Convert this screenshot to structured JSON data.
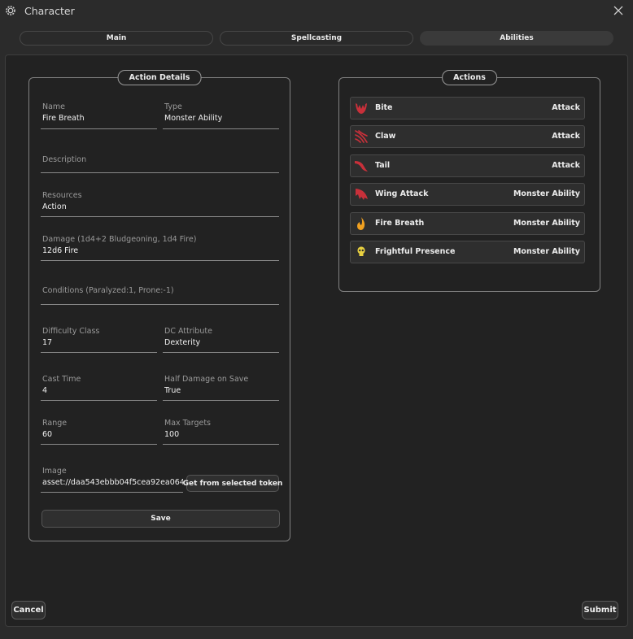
{
  "window": {
    "title": "Character",
    "app_icon": "gear-icon",
    "close_icon": "close-icon"
  },
  "tabs": [
    {
      "label": "Main"
    },
    {
      "label": "Spellcasting"
    },
    {
      "label": "Abilities",
      "selected": true
    }
  ],
  "details": {
    "title": "Action Details",
    "fields": {
      "name": {
        "label": "Name",
        "value": "Fire Breath"
      },
      "type": {
        "label": "Type",
        "value": "Monster Ability"
      },
      "description": {
        "label": "Description",
        "value": ""
      },
      "resources": {
        "label": "Resources",
        "value": "Action"
      },
      "damage": {
        "label": "Damage (1d4+2 Bludgeoning, 1d4 Fire)",
        "value": "12d6 Fire"
      },
      "conditions": {
        "label": "Conditions (Paralyzed:1, Prone:-1)",
        "value": ""
      },
      "dc": {
        "label": "Difficulty Class",
        "value": "17"
      },
      "dc_attribute": {
        "label": "DC Attribute",
        "value": "Dexterity"
      },
      "cast_time": {
        "label": "Cast Time",
        "value": "4"
      },
      "half_damage": {
        "label": "Half Damage on Save",
        "value": "True"
      },
      "range": {
        "label": "Range",
        "value": "60"
      },
      "max_targets": {
        "label": "Max Targets",
        "value": "100"
      },
      "image": {
        "label": "Image",
        "value": "asset://daa543ebbb04f5cea92ea064"
      }
    },
    "get_token_label": "Get from selected token",
    "save_label": "Save"
  },
  "actions": {
    "title": "Actions",
    "items": [
      {
        "name": "Bite",
        "type": "Attack",
        "icon": "bite-icon"
      },
      {
        "name": "Claw",
        "type": "Attack",
        "icon": "claw-icon"
      },
      {
        "name": "Tail",
        "type": "Attack",
        "icon": "tail-icon"
      },
      {
        "name": "Wing Attack",
        "type": "Monster Ability",
        "icon": "wing-icon"
      },
      {
        "name": "Fire Breath",
        "type": "Monster Ability",
        "icon": "flame-icon"
      },
      {
        "name": "Frightful Presence",
        "type": "Monster Ability",
        "icon": "skull-icon"
      }
    ]
  },
  "footer": {
    "cancel_label": "Cancel",
    "submit_label": "Submit"
  },
  "colors": {
    "accent_red": "#c8303a",
    "flame_orange": "#f0a020",
    "skull_yellow": "#e8d040"
  }
}
